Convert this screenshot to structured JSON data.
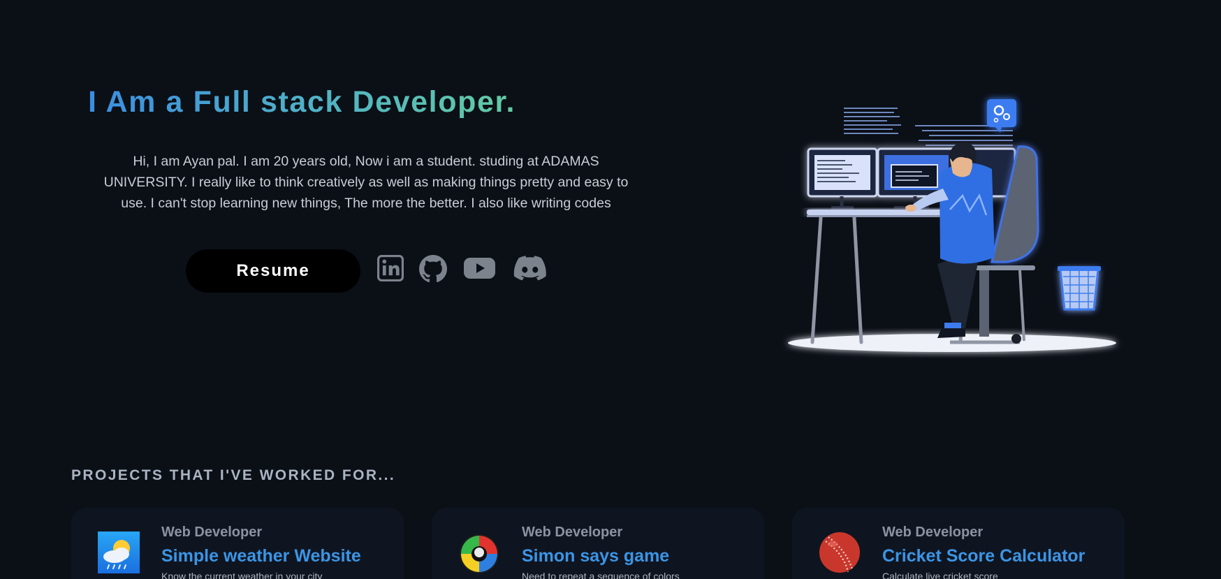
{
  "hero": {
    "title": "I Am a Full stack Developer.",
    "bio": "Hi, I am Ayan pal. I am 20 years old, Now i am a student. studing at ADAMAS UNIVERSITY. I really like to think creatively as well as making things pretty and easy to use. I can't stop learning new things, The more the better. I also like writing codes",
    "resume_label": "Resume",
    "socials": [
      {
        "icon": "linkedin-icon"
      },
      {
        "icon": "github-icon"
      },
      {
        "icon": "youtube-icon"
      },
      {
        "icon": "discord-icon"
      }
    ],
    "illustration": "developer-at-desk-illustration"
  },
  "projects": {
    "heading": "PROJECTS THAT I'VE WORKED FOR...",
    "items": [
      {
        "icon": "weather-icon",
        "role": "Web Developer",
        "title": "Simple weather Website",
        "desc": "Know the current weather in your city"
      },
      {
        "icon": "simon-game-icon",
        "role": "Web Developer",
        "title": "Simon says game",
        "desc": "Need to repeat a sequence of colors"
      },
      {
        "icon": "cricket-ball-icon",
        "role": "Web Developer",
        "title": "Cricket Score Calculator",
        "desc": "Calculate live cricket score"
      }
    ]
  },
  "colors": {
    "background": "#0b0f16",
    "accent_blue": "#3b95e6",
    "accent_green": "#63cba3",
    "icon_gray": "#7d838c"
  }
}
